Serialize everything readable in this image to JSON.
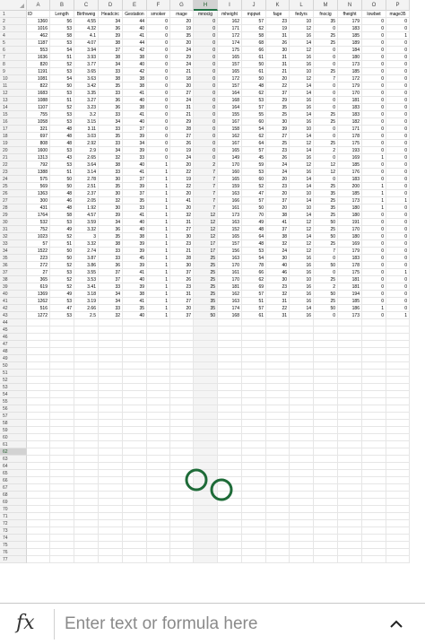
{
  "spreadsheet": {
    "columns": [
      "A",
      "B",
      "C",
      "D",
      "E",
      "F",
      "G",
      "H",
      "I",
      "J",
      "K",
      "L",
      "M",
      "N",
      "O",
      "P"
    ],
    "selected_column": "H",
    "selected_row": 62,
    "total_rows": 77,
    "header_row": [
      "ID",
      "Length",
      "Birthweig",
      "Headcirc",
      "Gestation",
      "smoker",
      "mage",
      "mnocig",
      "mheight",
      "mppwt",
      "fage",
      "fedyrs",
      "fnocig",
      "fheight",
      "lowbwt",
      "mage35"
    ],
    "rows": [
      [
        "1360",
        "56",
        "4.55",
        "34",
        "44",
        "0",
        "20",
        "0",
        "162",
        "57",
        "23",
        "10",
        "35",
        "179",
        "0",
        "0"
      ],
      [
        "1016",
        "53",
        "4.32",
        "36",
        "40",
        "0",
        "19",
        "0",
        "171",
        "62",
        "19",
        "12",
        "0",
        "183",
        "0",
        "0"
      ],
      [
        "462",
        "58",
        "4.1",
        "39",
        "41",
        "0",
        "35",
        "0",
        "172",
        "58",
        "31",
        "16",
        "25",
        "185",
        "0",
        "1"
      ],
      [
        "1187",
        "53",
        "4.07",
        "38",
        "44",
        "0",
        "20",
        "0",
        "174",
        "68",
        "26",
        "14",
        "25",
        "189",
        "0",
        "0"
      ],
      [
        "553",
        "54",
        "3.94",
        "37",
        "42",
        "0",
        "24",
        "0",
        "175",
        "66",
        "30",
        "12",
        "0",
        "184",
        "0",
        "0"
      ],
      [
        "1636",
        "51",
        "3.93",
        "38",
        "38",
        "0",
        "29",
        "0",
        "165",
        "61",
        "31",
        "16",
        "0",
        "180",
        "0",
        "0"
      ],
      [
        "820",
        "52",
        "3.77",
        "34",
        "40",
        "0",
        "24",
        "0",
        "157",
        "50",
        "31",
        "16",
        "0",
        "173",
        "0",
        "0"
      ],
      [
        "1191",
        "53",
        "3.65",
        "33",
        "42",
        "0",
        "21",
        "0",
        "165",
        "61",
        "21",
        "10",
        "25",
        "185",
        "0",
        "0"
      ],
      [
        "1081",
        "54",
        "3.63",
        "38",
        "38",
        "0",
        "18",
        "0",
        "172",
        "50",
        "20",
        "12",
        "7",
        "172",
        "0",
        "0"
      ],
      [
        "822",
        "50",
        "3.42",
        "35",
        "38",
        "0",
        "20",
        "0",
        "157",
        "48",
        "22",
        "14",
        "0",
        "179",
        "0",
        "0"
      ],
      [
        "1683",
        "53",
        "3.35",
        "33",
        "41",
        "0",
        "27",
        "0",
        "164",
        "62",
        "37",
        "14",
        "0",
        "170",
        "0",
        "0"
      ],
      [
        "1088",
        "51",
        "3.27",
        "36",
        "40",
        "0",
        "24",
        "0",
        "168",
        "53",
        "29",
        "16",
        "0",
        "181",
        "0",
        "0"
      ],
      [
        "1107",
        "52",
        "3.23",
        "36",
        "38",
        "0",
        "31",
        "0",
        "164",
        "57",
        "35",
        "16",
        "0",
        "183",
        "0",
        "0"
      ],
      [
        "755",
        "53",
        "3.2",
        "33",
        "41",
        "0",
        "21",
        "0",
        "155",
        "55",
        "25",
        "14",
        "25",
        "183",
        "0",
        "0"
      ],
      [
        "1058",
        "53",
        "3.15",
        "34",
        "40",
        "0",
        "29",
        "0",
        "167",
        "60",
        "30",
        "16",
        "25",
        "182",
        "0",
        "0"
      ],
      [
        "321",
        "48",
        "3.11",
        "33",
        "37",
        "0",
        "28",
        "0",
        "158",
        "54",
        "39",
        "10",
        "0",
        "171",
        "0",
        "0"
      ],
      [
        "697",
        "48",
        "3.03",
        "35",
        "39",
        "0",
        "27",
        "0",
        "162",
        "62",
        "27",
        "14",
        "0",
        "178",
        "0",
        "0"
      ],
      [
        "808",
        "48",
        "2.92",
        "33",
        "34",
        "0",
        "26",
        "0",
        "167",
        "64",
        "25",
        "12",
        "25",
        "175",
        "0",
        "0"
      ],
      [
        "1600",
        "53",
        "2.9",
        "34",
        "39",
        "0",
        "19",
        "0",
        "165",
        "57",
        "23",
        "14",
        "2",
        "193",
        "0",
        "0"
      ],
      [
        "1313",
        "43",
        "2.65",
        "32",
        "33",
        "0",
        "24",
        "0",
        "149",
        "45",
        "26",
        "16",
        "0",
        "169",
        "1",
        "0"
      ],
      [
        "792",
        "53",
        "3.64",
        "38",
        "40",
        "1",
        "20",
        "2",
        "170",
        "59",
        "24",
        "12",
        "12",
        "185",
        "0",
        "0"
      ],
      [
        "1388",
        "51",
        "3.14",
        "33",
        "41",
        "1",
        "22",
        "7",
        "160",
        "53",
        "24",
        "16",
        "12",
        "176",
        "0",
        "0"
      ],
      [
        "575",
        "50",
        "2.78",
        "30",
        "37",
        "1",
        "19",
        "7",
        "165",
        "60",
        "20",
        "14",
        "0",
        "183",
        "0",
        "0"
      ],
      [
        "569",
        "50",
        "2.51",
        "35",
        "39",
        "1",
        "22",
        "7",
        "159",
        "52",
        "23",
        "14",
        "25",
        "200",
        "1",
        "0"
      ],
      [
        "1363",
        "48",
        "2.37",
        "30",
        "37",
        "1",
        "20",
        "7",
        "163",
        "47",
        "20",
        "10",
        "35",
        "185",
        "1",
        "0"
      ],
      [
        "300",
        "46",
        "2.05",
        "32",
        "35",
        "1",
        "41",
        "7",
        "166",
        "57",
        "37",
        "14",
        "25",
        "173",
        "1",
        "1"
      ],
      [
        "431",
        "48",
        "1.92",
        "30",
        "33",
        "1",
        "20",
        "7",
        "161",
        "50",
        "20",
        "10",
        "35",
        "180",
        "1",
        "0"
      ],
      [
        "1764",
        "58",
        "4.57",
        "39",
        "41",
        "1",
        "32",
        "12",
        "173",
        "70",
        "38",
        "14",
        "25",
        "180",
        "0",
        "0"
      ],
      [
        "532",
        "53",
        "3.59",
        "34",
        "40",
        "1",
        "31",
        "12",
        "163",
        "49",
        "41",
        "12",
        "50",
        "191",
        "0",
        "0"
      ],
      [
        "752",
        "49",
        "3.32",
        "36",
        "40",
        "1",
        "27",
        "12",
        "152",
        "48",
        "37",
        "12",
        "25",
        "170",
        "0",
        "0"
      ],
      [
        "1023",
        "52",
        "3",
        "35",
        "38",
        "1",
        "30",
        "12",
        "165",
        "64",
        "38",
        "14",
        "50",
        "180",
        "0",
        "0"
      ],
      [
        "57",
        "51",
        "3.32",
        "38",
        "39",
        "1",
        "23",
        "17",
        "157",
        "48",
        "32",
        "12",
        "25",
        "169",
        "0",
        "0"
      ],
      [
        "1522",
        "50",
        "2.74",
        "33",
        "39",
        "1",
        "21",
        "17",
        "156",
        "53",
        "24",
        "12",
        "7",
        "179",
        "0",
        "0"
      ],
      [
        "223",
        "50",
        "3.87",
        "33",
        "45",
        "1",
        "28",
        "25",
        "163",
        "54",
        "30",
        "16",
        "0",
        "183",
        "0",
        "0"
      ],
      [
        "272",
        "52",
        "3.86",
        "36",
        "39",
        "1",
        "30",
        "25",
        "170",
        "78",
        "40",
        "16",
        "50",
        "178",
        "0",
        "0"
      ],
      [
        "27",
        "53",
        "3.55",
        "37",
        "41",
        "1",
        "37",
        "25",
        "161",
        "66",
        "46",
        "16",
        "0",
        "175",
        "0",
        "1"
      ],
      [
        "365",
        "52",
        "3.53",
        "37",
        "40",
        "1",
        "26",
        "25",
        "170",
        "62",
        "30",
        "10",
        "25",
        "181",
        "0",
        "0"
      ],
      [
        "619",
        "52",
        "3.41",
        "33",
        "39",
        "1",
        "23",
        "25",
        "181",
        "69",
        "23",
        "16",
        "2",
        "181",
        "0",
        "0"
      ],
      [
        "1369",
        "49",
        "3.18",
        "34",
        "38",
        "1",
        "31",
        "25",
        "162",
        "57",
        "32",
        "16",
        "50",
        "194",
        "0",
        "0"
      ],
      [
        "1262",
        "53",
        "3.19",
        "34",
        "41",
        "1",
        "27",
        "35",
        "163",
        "51",
        "31",
        "16",
        "25",
        "185",
        "0",
        "0"
      ],
      [
        "516",
        "47",
        "2.66",
        "33",
        "35",
        "1",
        "20",
        "35",
        "174",
        "57",
        "22",
        "14",
        "50",
        "186",
        "1",
        "0"
      ],
      [
        "1272",
        "53",
        "2.5",
        "32",
        "40",
        "1",
        "37",
        "50",
        "168",
        "61",
        "31",
        "16",
        "0",
        "173",
        "0",
        "1"
      ]
    ]
  },
  "formula_bar": {
    "icon": "fx-icon",
    "fx_label": "fx",
    "placeholder": "Enter text or formula here",
    "value": "",
    "expand_icon": "chevron-up-icon"
  },
  "overlay": {
    "touch_indicator_icon": "double-circle-touch-icon",
    "color": "#1e6b38"
  },
  "colors": {
    "selection_accent": "#217346",
    "header_bg": "#f3f3f3",
    "grid_line": "#e6e6e6"
  }
}
